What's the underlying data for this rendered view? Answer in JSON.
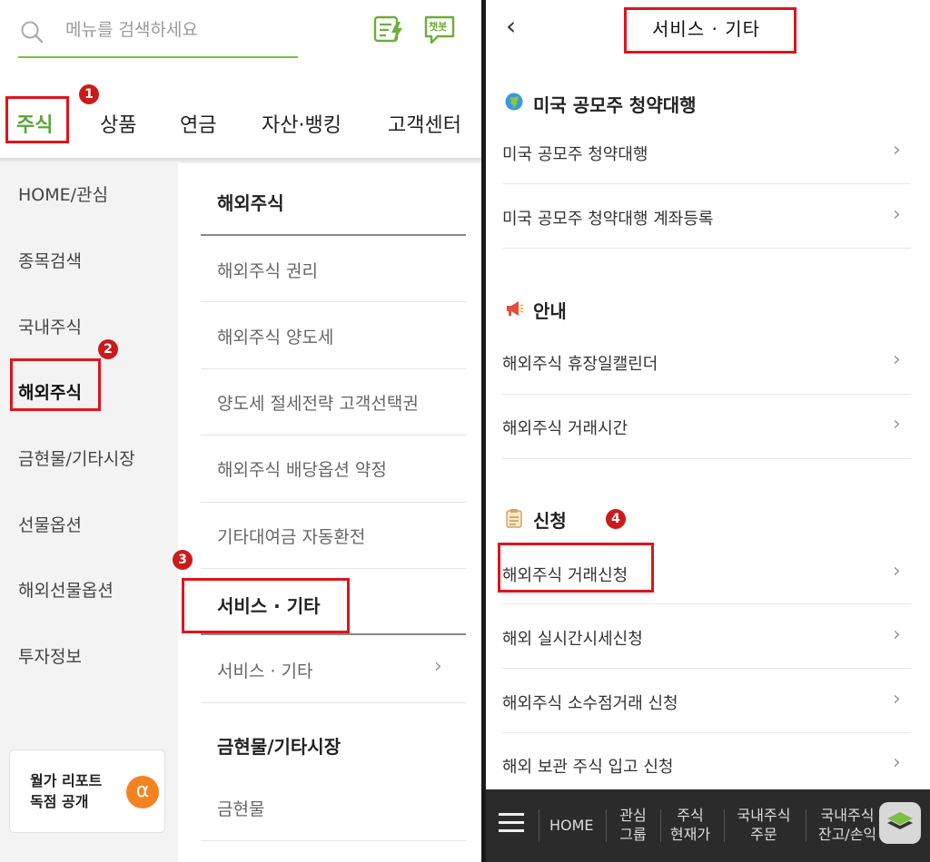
{
  "left": {
    "search": {
      "placeholder": "메뉴를 검색하세요"
    },
    "top_icons": {
      "quick": "quick-menu-icon",
      "chatbot": "챗봇"
    },
    "tabs": [
      "주식",
      "상품",
      "연금",
      "자산·뱅킹",
      "고객센터"
    ],
    "badges": [
      "1",
      "2",
      "3"
    ],
    "sidebar": [
      "HOME/관심",
      "종목검색",
      "국내주식",
      "해외주식",
      "금현물/기타시장",
      "선물옵션",
      "해외선물옵션",
      "투자정보"
    ],
    "submenu": {
      "heading": "해외주식",
      "items": [
        "해외주식 권리",
        "해외주식 양도세",
        "양도세 절세전략 고객선택권",
        "해외주식 배당옵션 약정",
        "기타대여금 자동환전"
      ],
      "service_heading": "서비스 · 기타",
      "service_item": "서비스 · 기타",
      "gold_heading": "금현물/기타시장",
      "gold_item": "금현물"
    },
    "promo": {
      "line1": "월가 리포트",
      "line2": "독점 공개",
      "icon": "α"
    }
  },
  "right": {
    "title": "서비스 · 기타",
    "sections": [
      {
        "heading": "미국 공모주 청약대행",
        "icon": "globe-icon",
        "items": [
          "미국 공모주 청약대행",
          "미국 공모주 청약대행 계좌등록"
        ]
      },
      {
        "heading": "안내",
        "icon": "megaphone-icon",
        "items": [
          "해외주식 휴장일캘린더",
          "해외주식 거래시간"
        ]
      },
      {
        "heading": "신청",
        "icon": "clipboard-icon",
        "items": [
          "해외주식 거래신청",
          "해외 실시간시세신청",
          "해외주식 소수점거래 신청",
          "해외 보관 주식 입고 신청"
        ]
      }
    ],
    "badge4": "4",
    "bottom_bar": {
      "home": "HOME",
      "items": [
        {
          "l1": "관심",
          "l2": "그룹"
        },
        {
          "l1": "주식",
          "l2": "현재가"
        },
        {
          "l1": "국내주식",
          "l2": "주문"
        },
        {
          "l1": "국내주식",
          "l2": "잔고/손익"
        }
      ]
    }
  },
  "colors": {
    "accent_green": "#59a53a",
    "highlight_red": "#e0141b",
    "badge_red": "#cc1a1a",
    "promo_orange": "#f58220"
  }
}
